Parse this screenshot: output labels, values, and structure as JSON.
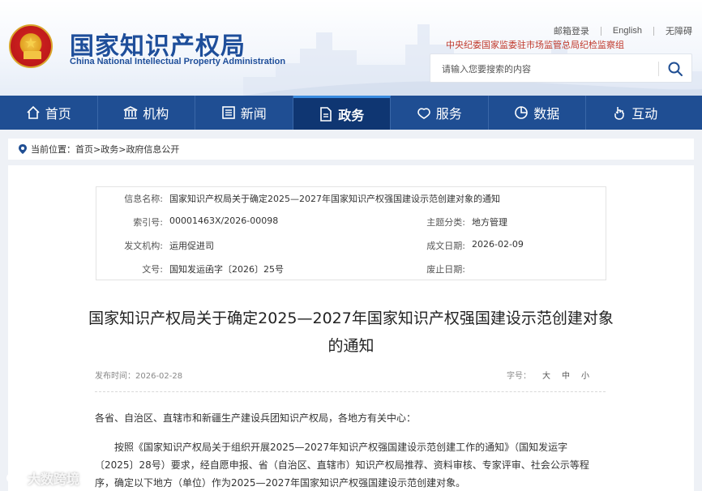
{
  "header": {
    "logo_cn": "国家知识产权局",
    "logo_en": "China National Intellectual Property Administration",
    "top_links": [
      "邮箱登录",
      "English",
      "无障碍"
    ],
    "discipline_text": "中央纪委国家监委驻市场监管总局纪检监察组",
    "search_placeholder": "请输入您要搜索的内容"
  },
  "nav": {
    "items": [
      {
        "label": "首页",
        "icon": "home-icon"
      },
      {
        "label": "机构",
        "icon": "institution-icon"
      },
      {
        "label": "新闻",
        "icon": "news-icon"
      },
      {
        "label": "政务",
        "icon": "document-icon"
      },
      {
        "label": "服务",
        "icon": "handshake-icon"
      },
      {
        "label": "数据",
        "icon": "pie-chart-icon"
      },
      {
        "label": "互动",
        "icon": "hand-pointer-icon"
      }
    ],
    "active": "政务",
    "active_color": "#0f3672",
    "bar_color": "#1f4e93"
  },
  "breadcrumb": {
    "prefix": "当前位置：",
    "items": [
      "首页",
      "政务",
      "政府信息公开"
    ],
    "separator": ">"
  },
  "meta": {
    "info_name_label": "信息名称:",
    "info_name": "国家知识产权局关于确定2025—2027年国家知识产权强国建设示范创建对象的通知",
    "index_label": "索引号:",
    "index": "00001463X/2026-00098",
    "topic_label": "主题分类:",
    "topic": "地方管理",
    "issuer_label": "发文机构:",
    "issuer": "运用促进司",
    "date_label": "成文日期:",
    "date": "2026-02-09",
    "docno_label": "文号:",
    "docno": "国知发运函字〔2026〕25号",
    "expiry_label": "废止日期:",
    "expiry": ""
  },
  "article": {
    "title_line1": "国家知识产权局关于确定2025—2027年国家知识产权强国建设示范创建对象",
    "title_line2": "的通知",
    "publish_time": "发布时间：2026-02-28",
    "font_size_label": "字号：",
    "font_sizes": [
      "大",
      "中",
      "小"
    ],
    "salutation": "各省、自治区、直辖市和新疆生产建设兵团知识产权局，各地方有关中心：",
    "paragraph": "按照《国家知识产权局关于组织开展2025—2027年知识产权强国建设示范创建工作的通知》（国知发运字〔2025〕28号）要求，经自愿申报、省（自治区、直辖市）知识产权局推荐、资料审核、专家评审、社会公示等程序，确定以下地方（单位）作为2025—2027年国家知识产权强国建设示范创建对象。"
  },
  "watermark": "大数跨境"
}
